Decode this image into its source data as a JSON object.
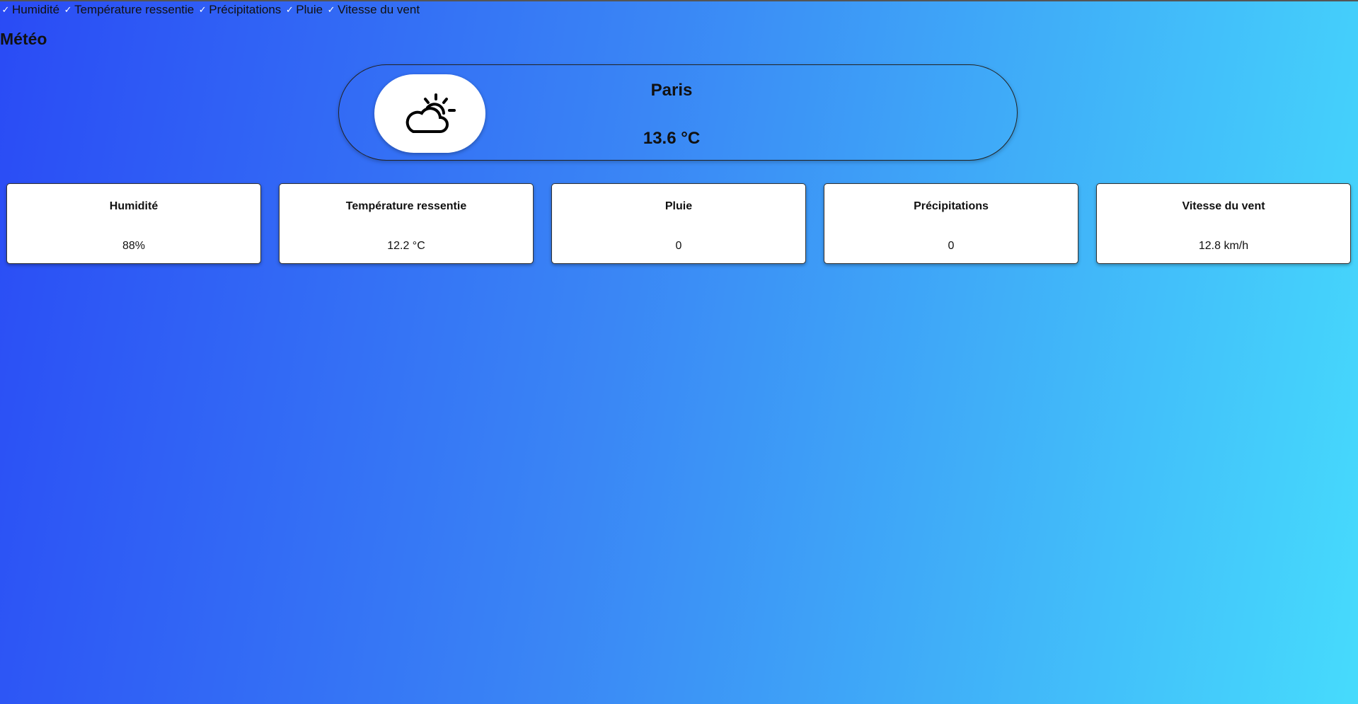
{
  "filters": [
    {
      "label": "Humidité",
      "checked": true
    },
    {
      "label": "Température ressentie",
      "checked": true
    },
    {
      "label": "Précipitations",
      "checked": true
    },
    {
      "label": "Pluie",
      "checked": true
    },
    {
      "label": "Vitesse du vent",
      "checked": true
    }
  ],
  "app": {
    "title": "Météo"
  },
  "current": {
    "city": "Paris",
    "temperature": "13.6 °C",
    "icon": "partly-cloudy-icon"
  },
  "cards": [
    {
      "title": "Humidité",
      "value": "88%"
    },
    {
      "title": "Température ressentie",
      "value": "12.2 °C"
    },
    {
      "title": "Pluie",
      "value": "0"
    },
    {
      "title": "Précipitations",
      "value": "0"
    },
    {
      "title": "Vitesse du vent",
      "value": "12.8 km/h"
    }
  ],
  "colors": {
    "gradient_start": "#2a4bf5",
    "gradient_mid": "#3a86f5",
    "gradient_end": "#46dbfc"
  }
}
